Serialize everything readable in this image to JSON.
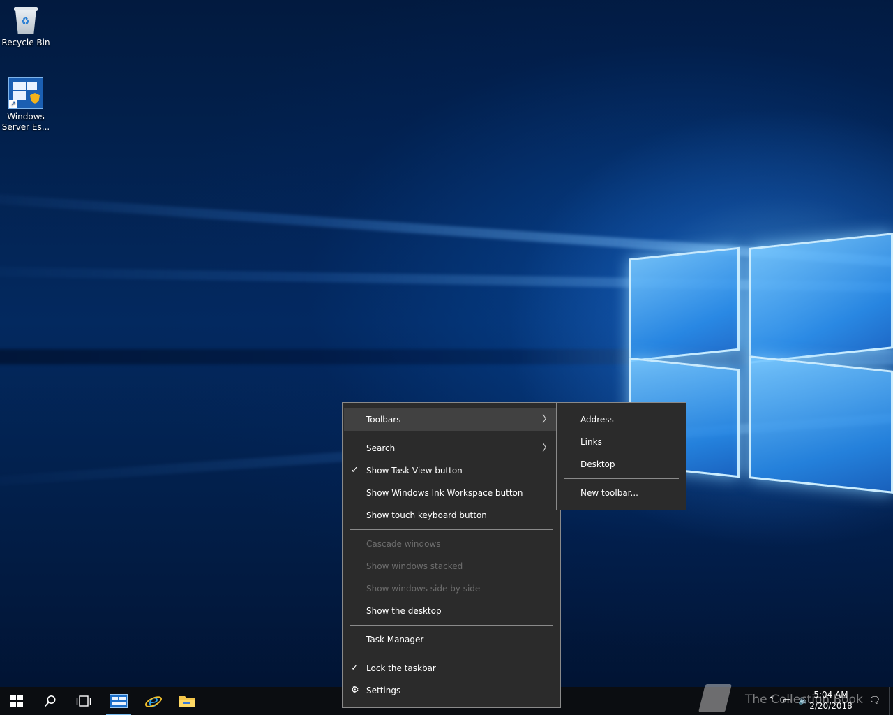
{
  "desktop": {
    "icons": [
      {
        "label": "Recycle Bin"
      },
      {
        "label_line1": "Windows",
        "label_line2": "Server Es..."
      }
    ]
  },
  "context_menu": {
    "toolbars": "Toolbars",
    "search": "Search",
    "show_task_view": "Show Task View button",
    "show_ink_workspace": "Show Windows Ink Workspace button",
    "show_touch_keyboard": "Show touch keyboard button",
    "cascade_windows": "Cascade windows",
    "show_stacked": "Show windows stacked",
    "show_side_by_side": "Show windows side by side",
    "show_desktop": "Show the desktop",
    "task_manager": "Task Manager",
    "lock_taskbar": "Lock the taskbar",
    "settings": "Settings",
    "checked_items": [
      "Show Task View button",
      "Lock the taskbar"
    ],
    "disabled_items": [
      "Cascade windows",
      "Show windows stacked",
      "Show windows side by side"
    ],
    "highlighted_item": "Toolbars"
  },
  "toolbars_submenu": {
    "address": "Address",
    "links": "Links",
    "desktop": "Desktop",
    "new_toolbar": "New toolbar..."
  },
  "taskbar": {
    "pinned": [
      "start-icon",
      "search-icon",
      "task-view-icon",
      "server-manager-icon",
      "internet-explorer-icon",
      "file-explorer-icon"
    ],
    "clock_time": "5:04 AM",
    "clock_date": "2/20/2018"
  },
  "watermark": {
    "text": "The Collection Book"
  },
  "colors": {
    "menu_bg": "#2b2b2b",
    "menu_hover": "#414141",
    "menu_border": "#8a8a8a",
    "disabled_text": "#6d6d6d",
    "taskbar_bg": "#0b0d11",
    "accent": "#76b9ed"
  }
}
